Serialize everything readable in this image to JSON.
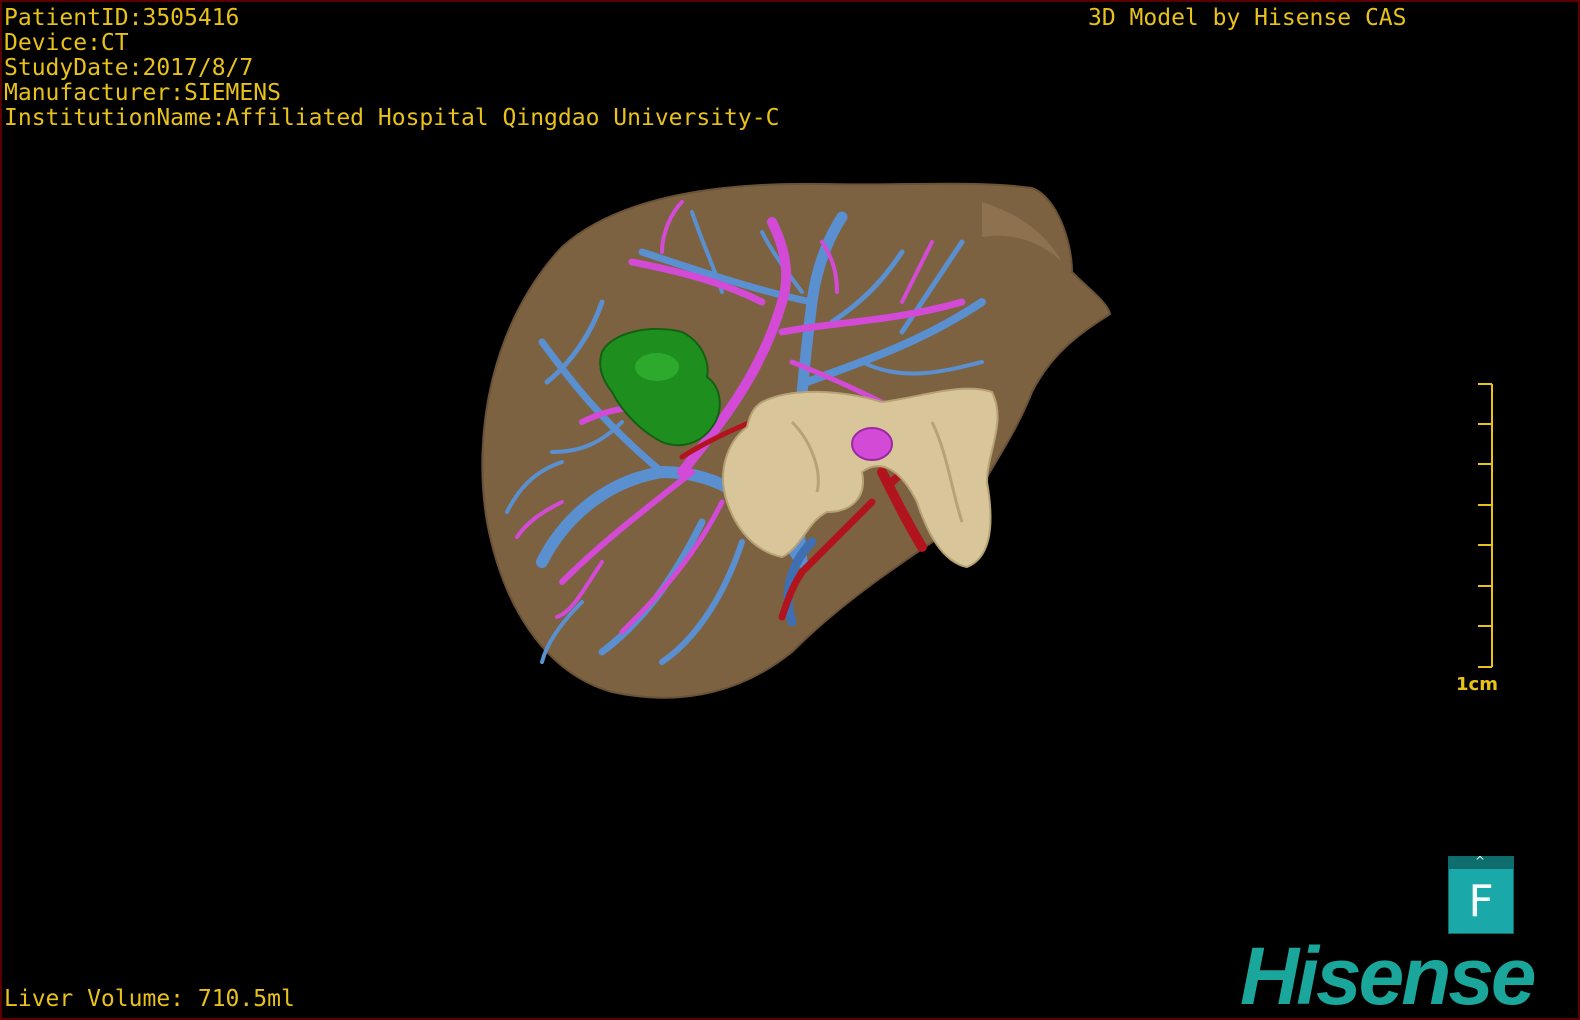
{
  "overlay": {
    "patient_id": "PatientID:3505416",
    "device": "Device:CT",
    "study_date": "StudyDate:2017/8/7",
    "manufacturer": "Manufacturer:SIEMENS",
    "institution": "InstitutionName:Affiliated Hospital Qingdao University-C",
    "model_credit": "3D Model by Hisense CAS",
    "liver_volume": "Liver Volume: 710.5ml"
  },
  "scale_bar": {
    "label": "1cm"
  },
  "orientation_cube": {
    "face_label": "F",
    "top_glyph": "^"
  },
  "brand": {
    "logo_text": "Hisense"
  },
  "colors": {
    "overlay_text": "#e8c21a",
    "liver": "#7d6242",
    "portal_vein": "#5a8fd0",
    "hepatic_vein": "#d24ad6",
    "artery": "#b1141c",
    "tumor": "#1e8f1e",
    "pancreas": "#d8c59a",
    "brand": "#1aa69a"
  }
}
